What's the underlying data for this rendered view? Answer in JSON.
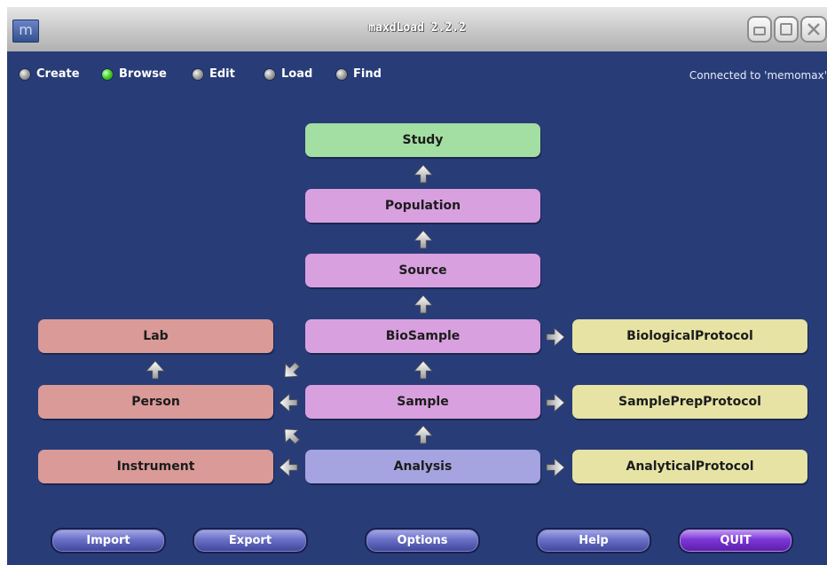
{
  "window": {
    "title": "maxdLoad 2.2.2",
    "app_icon": "m"
  },
  "modes": [
    {
      "label": "Create",
      "selected": false
    },
    {
      "label": "Browse",
      "selected": true
    },
    {
      "label": "Edit",
      "selected": false
    },
    {
      "label": "Load",
      "selected": false
    },
    {
      "label": "Find",
      "selected": false
    }
  ],
  "status": {
    "connection": "Connected to 'memomax'"
  },
  "nodes": {
    "study": "Study",
    "population": "Population",
    "source": "Source",
    "biosample": "BioSample",
    "sample": "Sample",
    "analysis": "Analysis",
    "lab": "Lab",
    "person": "Person",
    "instrument": "Instrument",
    "biological_protocol": "BiologicalProtocol",
    "sampleprep_protocol": "SamplePrepProtocol",
    "analytical_protocol": "AnalyticalProtocol"
  },
  "buttons": {
    "import": "Import",
    "export": "Export",
    "options": "Options",
    "help": "Help",
    "quit": "QUIT"
  },
  "colors": {
    "background": "#283c78",
    "study": "#a3dea2",
    "sample_chain": "#d9a0e0",
    "people": "#d99a98",
    "protocols": "#e6e3a5",
    "analysis": "#a5a3e0"
  },
  "icons": {
    "window_controls": [
      "minimize-icon",
      "maximize-icon",
      "close-icon"
    ],
    "connectors": "arrow-icon"
  }
}
